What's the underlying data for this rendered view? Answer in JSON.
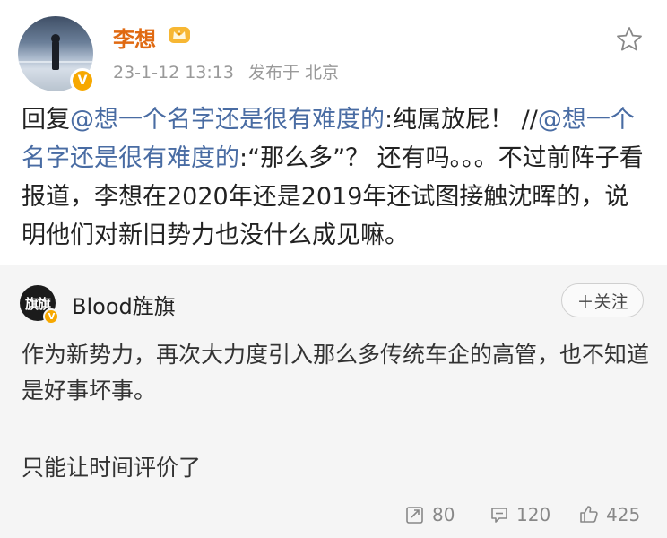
{
  "post": {
    "username": "李想",
    "timestamp": "23-1-12 13:13",
    "location": "发布于 北京",
    "content": {
      "reply_prefix": "回复",
      "mention_1": "@想一个名字还是很有难度的",
      "text_1": ":纯属放屁！ //",
      "mention_2": "@想一个名字还是很有难度的",
      "text_2": ":“那么多”？ 还有吗。。。不过前阵子看报道，李想在2020年还是2019年还试图接触沈晖的，说明他们对新旧势力也没什么成见嘛。"
    }
  },
  "repost": {
    "avatar_text": "旗旗",
    "username": "Blood旌旗",
    "follow_label": "＋关注",
    "paragraph_1": "作为新势力，再次大力度引入那么多传统车企的高管，也不知道是好事坏事。",
    "paragraph_2": "只能让时间评价了"
  },
  "stats": {
    "reposts": "80",
    "comments": "120",
    "likes": "425"
  },
  "colors": {
    "username": "#e06a12",
    "mention": "#496ca3",
    "verified_badge": "#f7a800",
    "card_background": "#f5f5f5"
  },
  "icons": {
    "verified": "v-badge-icon",
    "vip": "crown-icon",
    "favorite": "star-icon",
    "repost": "repost-icon",
    "comment": "comment-icon",
    "like": "thumbs-up-icon"
  }
}
